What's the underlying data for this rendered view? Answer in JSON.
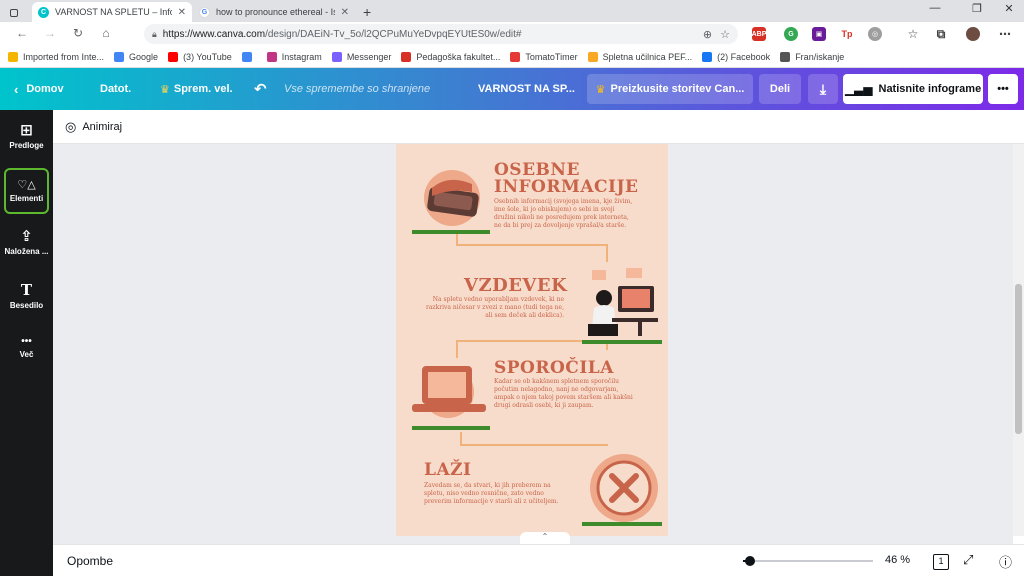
{
  "browser": {
    "tabs": [
      {
        "title": "VARNOST NA SPLETU – Infograp",
        "active": true
      },
      {
        "title": "how to pronounce ethereal - Isk",
        "active": false
      }
    ],
    "new_tab": "+",
    "url_host": "https://www.canva.com",
    "url_path": "/design/DAEiN-Tv_5o/l2QCPuMuYeDvpqEYUtES0w/edit#"
  },
  "bookmarks": [
    {
      "label": "Imported from Inte...",
      "color": "#f4b400"
    },
    {
      "label": "Google",
      "color": "#4285f4"
    },
    {
      "label": "(3) YouTube",
      "color": "#ff0000"
    },
    {
      "label": "",
      "color": "#4285f4"
    },
    {
      "label": "Instagram",
      "color": "#c13584"
    },
    {
      "label": "Messenger",
      "color": "#7b61ff"
    },
    {
      "label": "Pedagoška fakultet...",
      "color": "#d93025"
    },
    {
      "label": "TomatoTimer",
      "color": "#e53935"
    },
    {
      "label": "Spletna učilnica PEF...",
      "color": "#f9a825"
    },
    {
      "label": "(2) Facebook",
      "color": "#1877f2"
    },
    {
      "label": "Fran/iskanje",
      "color": "#555555"
    }
  ],
  "canva": {
    "home": "Domov",
    "file": "Datot.",
    "resize": "Sprem. vel.",
    "saved": "Vse spremembe so shranjene",
    "doc_title": "VARNOST NA SP...",
    "trial": "Preizkusite storitev Can...",
    "share": "Deli",
    "print": "Natisnite infograme",
    "more": "•••"
  },
  "sidebar": [
    {
      "label": "Predloge",
      "icon": "⊞"
    },
    {
      "label": "Elementi",
      "icon": "♡△"
    },
    {
      "label": "Naložena ...",
      "icon": "⇪"
    },
    {
      "label": "Besedilo",
      "icon": "T"
    },
    {
      "label": "Več",
      "icon": "•••"
    }
  ],
  "editor": {
    "animate": "Animiraj",
    "notes": "Opombe",
    "zoom": "46 %",
    "zoom_fraction": 0.05,
    "page_count": "1"
  },
  "infographic": {
    "sections": [
      {
        "title_line1": "OSEBNE",
        "title_line2": "INFORMACIJE",
        "body": "Osebnih informacij (svojega imena, kje živim, ime šole, ki jo obiskujem) o sebi in svoji družini nikoli ne posredujem prek interneta, ne da bi prej za dovoljenje vprašal/a starše."
      },
      {
        "title_line1": "VZDEVEK",
        "title_line2": "",
        "body": "Na spletu vedno uporabljam vzdevek, ki ne razkriva ničesar v zvezi z mano (tudi tega ne, ali sem deček ali deklica)."
      },
      {
        "title_line1": "SPOROČILA",
        "title_line2": "",
        "body": "Kadar se ob kakšnem spletnem sporočilu počutim nelagodno, nanj ne odgovarjam, ampak o njem takoj povem staršem ali kakšni drugi odrasli osebi, ki ji zaupam."
      },
      {
        "title_line1": "LAŽI",
        "title_line2": "",
        "body": "Zavedam se, da stvari, ki jih preberem na spletu, niso vedno resnične, zato vedno preverim informacije v starši ali z učiteljem."
      }
    ],
    "colors": {
      "bg": "#f8dccb",
      "accent": "#c8644a",
      "green": "#3e8b2c",
      "line": "#f0b27a"
    }
  }
}
